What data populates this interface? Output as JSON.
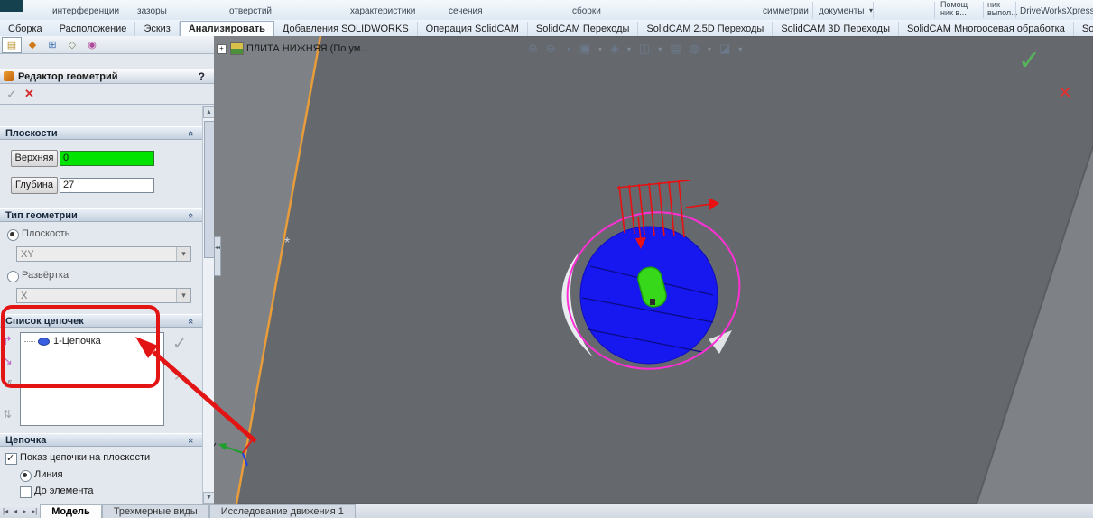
{
  "ribbon_top": {
    "fragments": [
      "интерференции",
      "зазоры",
      "отверстий",
      "характеристики",
      "сечения",
      "сборки",
      "симметрии",
      "документы",
      "Помощ ник в...",
      "ник выпол...",
      "DriveWorksXpress"
    ]
  },
  "ribbon_tabs": {
    "items": [
      "Сборка",
      "Расположение",
      "Эскиз",
      "Анализировать",
      "Добавления SOLIDWORKS",
      "Операция  SolidCAM",
      "SolidCAM Переходы",
      "SolidCAM 2.5D Переходы",
      "SolidCAM 3D Переходы",
      "SolidCAM Многоосевая обработка",
      "SolidCAM Токарн..."
    ]
  },
  "pm": {
    "title": "Редактор геометрий",
    "help": "?",
    "planes": {
      "title": "Плоскости",
      "upper_label": "Верхняя",
      "upper_value": "0",
      "depth_label": "Глубина",
      "depth_value": "27"
    },
    "geom_type": {
      "title": "Тип геометрии",
      "plane_radio": "Плоскость",
      "plane_select": "XY",
      "unfold_radio": "Развёртка",
      "unfold_select": "X"
    },
    "chain_list": {
      "title": "Список цепочек",
      "item": "1-Цепочка"
    },
    "chain": {
      "title": "Цепочка",
      "show_label": "Показ цепочки на плоскости",
      "line_label": "Линия",
      "to_element_label": "До элемента"
    }
  },
  "viewport": {
    "tree_item": "ПЛИТА НИЖНЯЯ  (По ум...",
    "axis_label": "Y"
  },
  "status_bar": {
    "tabs": [
      "Модель",
      "Трехмерные виды",
      "Исследование движения 1"
    ]
  },
  "icons": {
    "chevron": "«",
    "caret": "▾",
    "check": "✓",
    "cross": "✕",
    "scroll_up": "▲",
    "scroll_down": "▼",
    "expand_plus": "+",
    "collapse_left": "◂◂",
    "nav": [
      "|◂",
      "◂",
      "▸",
      "▸|"
    ],
    "toolbar": [
      "⊕",
      "⊖",
      "◔",
      "▣",
      "◈",
      "◫",
      "▤",
      "◍",
      "◪"
    ],
    "chain_tools": [
      "↱",
      "↘",
      "↺",
      "⇅"
    ],
    "pm_tabs": [
      "▤",
      "◆",
      "⊞",
      "◇",
      "◉"
    ],
    "asterisk": "*"
  },
  "colors": {
    "selected_edge": "#e89c3a",
    "chain_magenta": "#ff2fd6",
    "pocket_blue": "#1717ef",
    "island_green": "#37d81a",
    "annotation_red": "#e21414",
    "value_bg_green": "#00e400"
  }
}
